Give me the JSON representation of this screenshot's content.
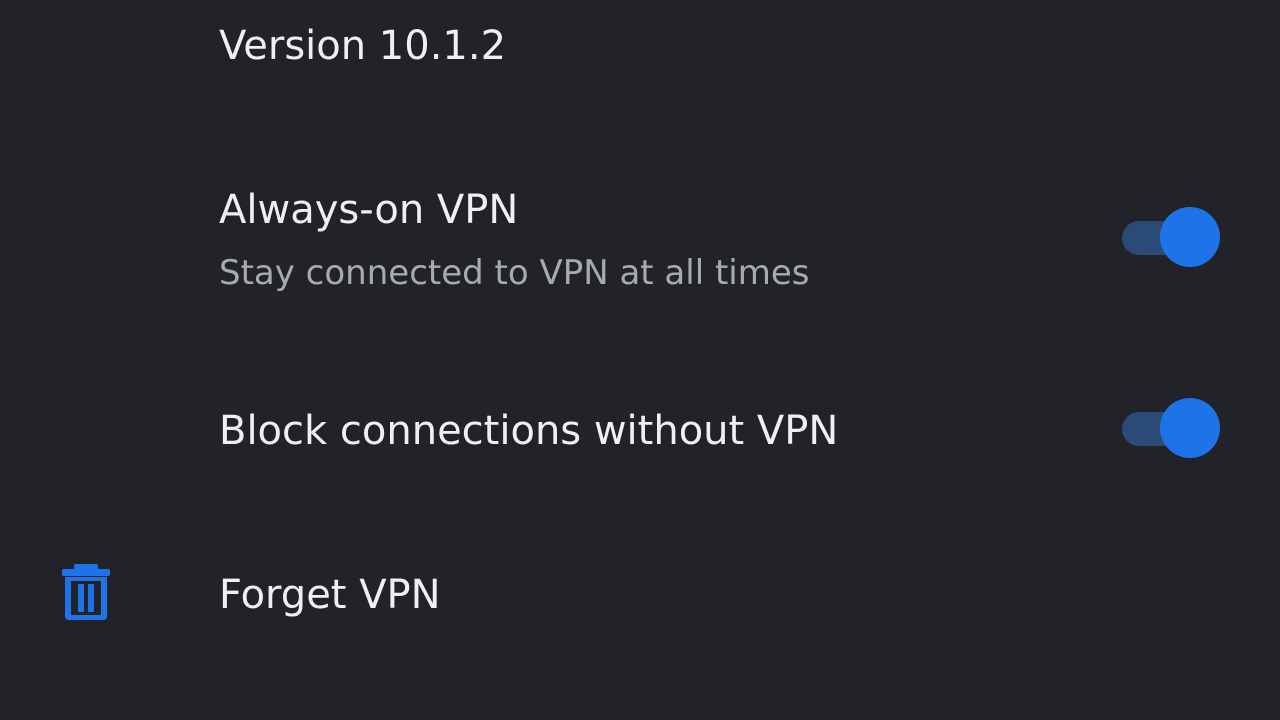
{
  "header": {
    "version_text": "Version 10.1.2"
  },
  "settings": {
    "always_on": {
      "title": "Always-on VPN",
      "subtitle": "Stay connected to VPN at all times",
      "enabled": true
    },
    "block_connections": {
      "title": "Block connections without VPN",
      "enabled": true
    },
    "forget": {
      "title": "Forget VPN",
      "icon": "trash-icon"
    }
  },
  "colors": {
    "background": "#212328",
    "accent": "#1f73e8",
    "switch_track": "#2b4a76",
    "primary_text": "#eef0f2",
    "secondary_text": "#a7abb1"
  }
}
